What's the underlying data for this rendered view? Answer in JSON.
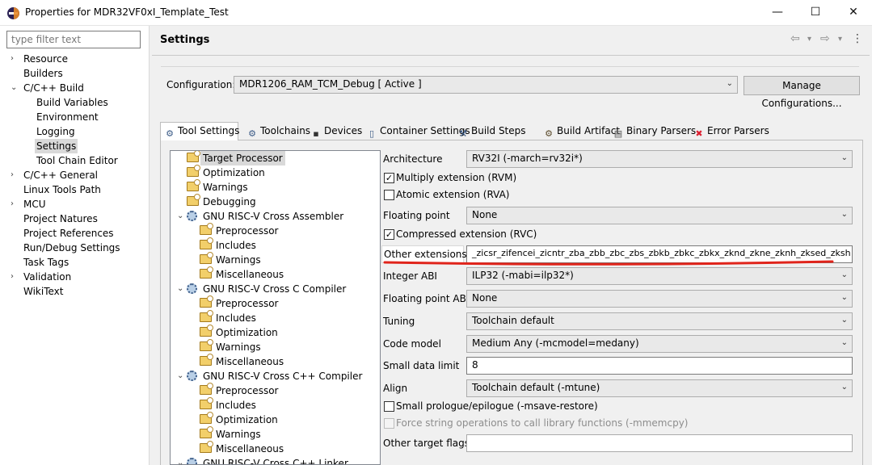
{
  "window": {
    "title": "Properties for MDR32VF0xI_Template_Test",
    "minimize": "—",
    "maximize": "☐",
    "close": "✕"
  },
  "filter": {
    "placeholder": "type filter text"
  },
  "nav": {
    "items": [
      {
        "label": "Resource",
        "expander": "›"
      },
      {
        "label": "Builders",
        "expander": ""
      },
      {
        "label": "C/C++ Build",
        "expander": "⌄"
      },
      {
        "label": "Build Variables",
        "expander": ""
      },
      {
        "label": "Environment",
        "expander": ""
      },
      {
        "label": "Logging",
        "expander": ""
      },
      {
        "label": "Settings",
        "expander": ""
      },
      {
        "label": "Tool Chain Editor",
        "expander": ""
      },
      {
        "label": "C/C++ General",
        "expander": "›"
      },
      {
        "label": "Linux Tools Path",
        "expander": ""
      },
      {
        "label": "MCU",
        "expander": "›"
      },
      {
        "label": "Project Natures",
        "expander": ""
      },
      {
        "label": "Project References",
        "expander": ""
      },
      {
        "label": "Run/Debug Settings",
        "expander": ""
      },
      {
        "label": "Task Tags",
        "expander": ""
      },
      {
        "label": "Validation",
        "expander": "›"
      },
      {
        "label": "WikiText",
        "expander": ""
      }
    ]
  },
  "header": {
    "title": "Settings",
    "back_icon": "⇦",
    "forward_icon": "⇨",
    "dropdown_icon": "▾",
    "menu_icon": "⋮"
  },
  "configuration": {
    "label": "Configuration:",
    "value": "MDR1206_RAM_TCM_Debug  [ Active ]",
    "manage_label": "Manage Configurations..."
  },
  "tabs": [
    {
      "label": "Tool Settings",
      "icon": "⚙"
    },
    {
      "label": "Toolchains",
      "icon": "⚙"
    },
    {
      "label": "Devices",
      "icon": "▪"
    },
    {
      "label": "Container Settings",
      "icon": "▯"
    },
    {
      "label": "Build Steps",
      "icon": "⚒"
    },
    {
      "label": "Build Artifact",
      "icon": "⚙"
    },
    {
      "label": "Binary Parsers",
      "icon": "▤"
    },
    {
      "label": "Error Parsers",
      "icon": "✖"
    }
  ],
  "tree": {
    "items": [
      {
        "label": "Target Processor"
      },
      {
        "label": "Optimization"
      },
      {
        "label": "Warnings"
      },
      {
        "label": "Debugging"
      },
      {
        "label": "GNU RISC-V Cross Assembler",
        "expander": "⌄"
      },
      {
        "label": "Preprocessor"
      },
      {
        "label": "Includes"
      },
      {
        "label": "Warnings"
      },
      {
        "label": "Miscellaneous"
      },
      {
        "label": "GNU RISC-V Cross C Compiler",
        "expander": "⌄"
      },
      {
        "label": "Preprocessor"
      },
      {
        "label": "Includes"
      },
      {
        "label": "Optimization"
      },
      {
        "label": "Warnings"
      },
      {
        "label": "Miscellaneous"
      },
      {
        "label": "GNU RISC-V Cross C++ Compiler",
        "expander": "⌄"
      },
      {
        "label": "Preprocessor"
      },
      {
        "label": "Includes"
      },
      {
        "label": "Optimization"
      },
      {
        "label": "Warnings"
      },
      {
        "label": "Miscellaneous"
      },
      {
        "label": "GNU RISC-V Cross C++ Linker",
        "expander": "⌄"
      }
    ]
  },
  "props": {
    "architecture": {
      "label": "Architecture",
      "value": "RV32I (-march=rv32i*)"
    },
    "multiply": {
      "label": "Multiply extension (RVM)",
      "checked": "✓"
    },
    "atomic": {
      "label": "Atomic extension (RVA)",
      "checked": ""
    },
    "floating_point": {
      "label": "Floating point",
      "value": "None"
    },
    "compressed": {
      "label": "Compressed extension (RVC)",
      "checked": "✓"
    },
    "other_ext": {
      "label": "Other extensions",
      "value": "_zicsr_zifencei_zicntr_zba_zbb_zbc_zbs_zbkb_zbkc_zbkx_zknd_zkne_zknh_zksed_zksh"
    },
    "integer_abi": {
      "label": "Integer ABI",
      "value": "ILP32 (-mabi=ilp32*)"
    },
    "fp_abi": {
      "label": "Floating point ABI",
      "value": "None"
    },
    "tuning": {
      "label": "Tuning",
      "value": "Toolchain default"
    },
    "code_model": {
      "label": "Code model",
      "value": "Medium Any (-mcmodel=medany)"
    },
    "small_data": {
      "label": "Small data limit",
      "value": "8"
    },
    "align": {
      "label": "Align",
      "value": "Toolchain default (-mtune)"
    },
    "small_prologue": {
      "label": "Small prologue/epilogue (-msave-restore)",
      "checked": ""
    },
    "force_string": {
      "label": "Force string operations to call library functions (-mmemcpy)",
      "checked": ""
    },
    "other_flags": {
      "label": "Other target flags",
      "value": ""
    }
  },
  "colors": {
    "underline": "#e0241b",
    "selection": "#d9d9d9"
  }
}
